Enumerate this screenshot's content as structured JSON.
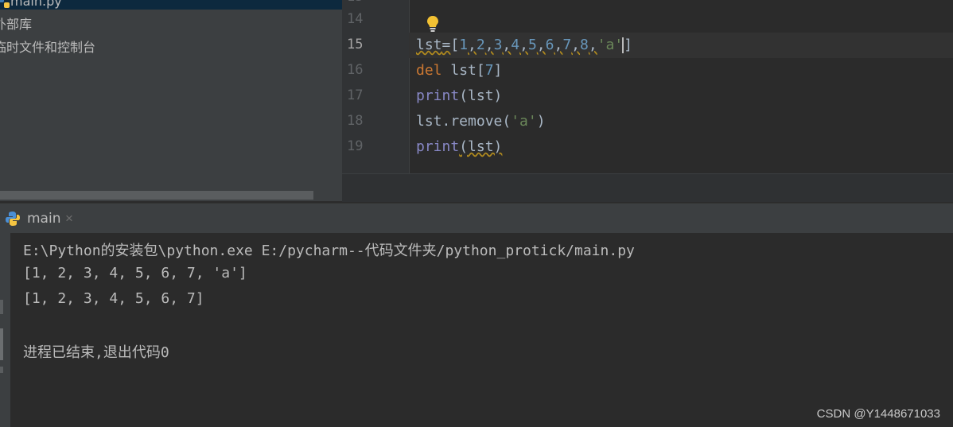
{
  "project": {
    "items": [
      {
        "label": "main.py"
      },
      {
        "label": "外部库"
      },
      {
        "label": "临时文件和控制台"
      }
    ]
  },
  "editor": {
    "line_numbers": [
      "14",
      "15",
      "16",
      "17",
      "18",
      "19"
    ],
    "code": {
      "line15": {
        "var": "lst",
        "eq": "=",
        "open": "[",
        "nums": [
          "1",
          "2",
          "3",
          "4",
          "5",
          "6",
          "7",
          "8"
        ],
        "str": "'a'",
        "close": "]"
      },
      "line16": {
        "kw": "del",
        "rest": " lst[",
        "idx": "7",
        "close": "]"
      },
      "line17": {
        "fn": "print",
        "args": "(lst)"
      },
      "line18": {
        "obj": "lst.remove(",
        "str": "'a'",
        "close": ")"
      },
      "line19": {
        "fn": "print",
        "args": "(lst)"
      }
    }
  },
  "run_panel": {
    "tab_label": "main",
    "close_glyph": "×"
  },
  "console": {
    "lines": [
      "E:\\Python的安装包\\python.exe E:/pycharm--代码文件夹/python_protick/main.py",
      "[1, 2, 3, 4, 5, 6, 7, 'a']",
      "[1, 2, 3, 4, 5, 6, 7]",
      "",
      "进程已结束,退出代码0"
    ]
  },
  "watermark": "CSDN @Y1448671033",
  "colors": {
    "keyword": "#cc7832",
    "builtin": "#8888c6",
    "number": "#6897bb",
    "string": "#6a8759"
  }
}
